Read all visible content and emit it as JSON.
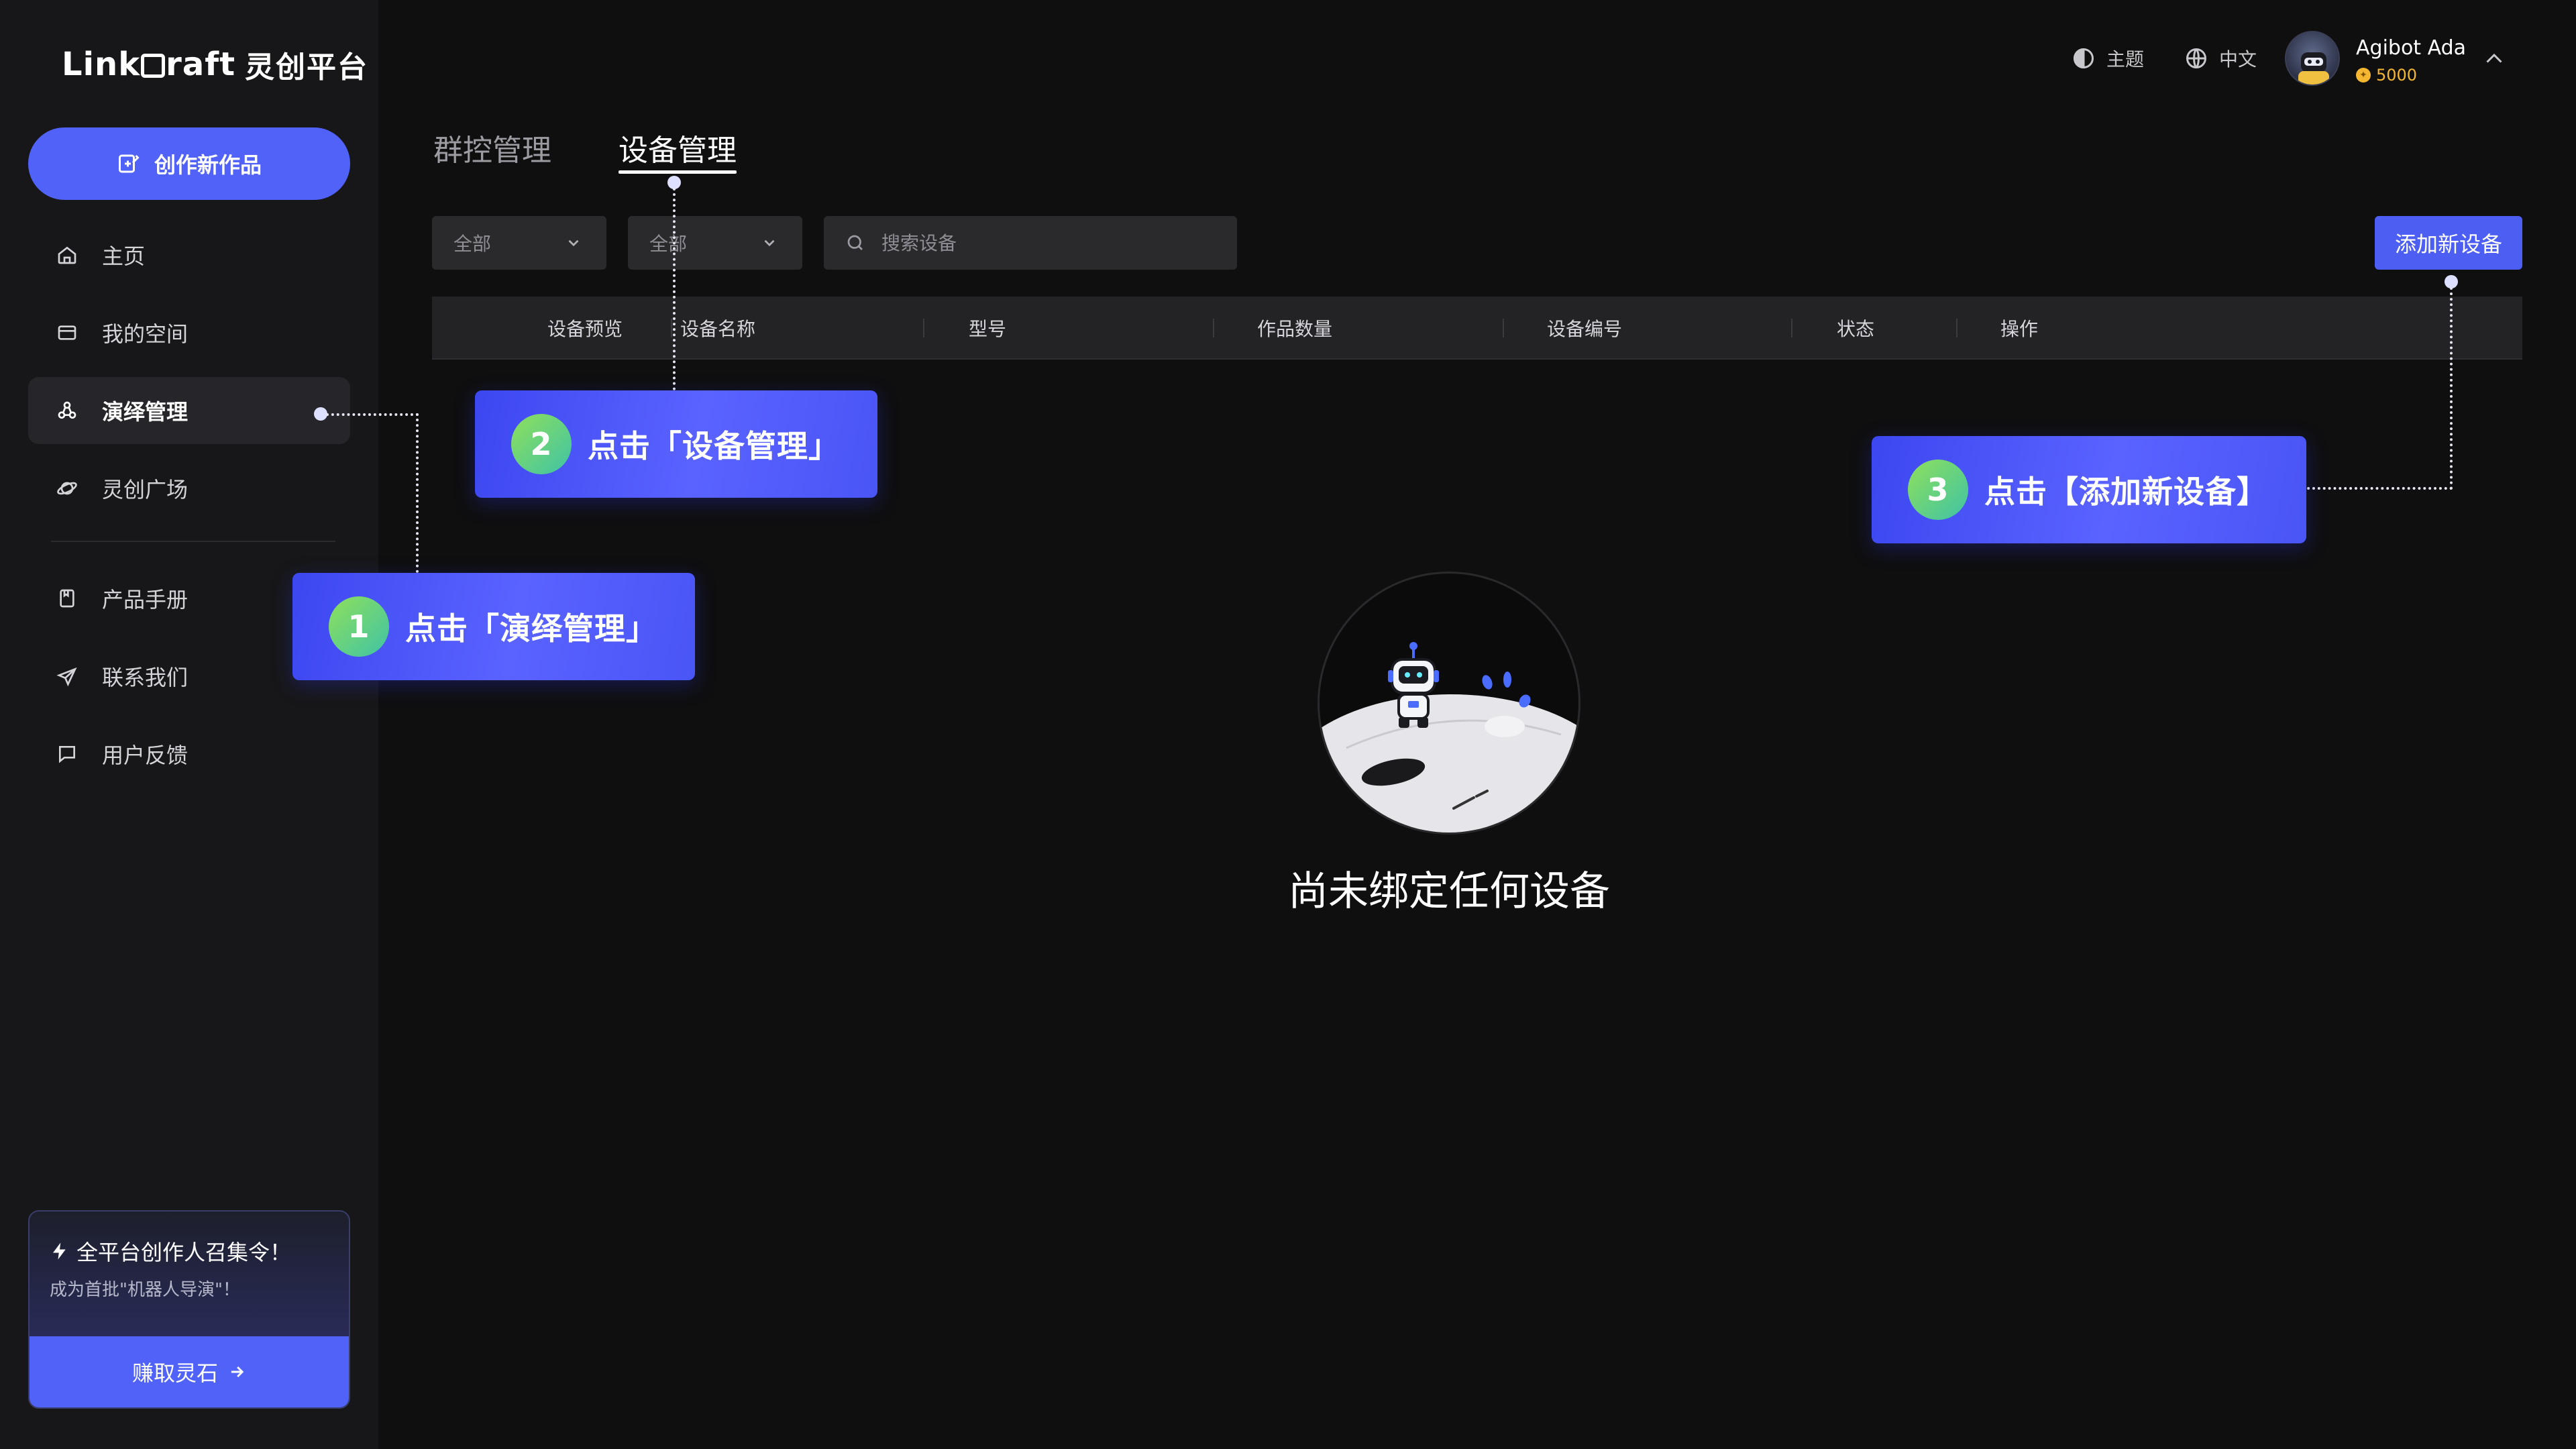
{
  "brand": {
    "name_en_left": "Link",
    "name_en_right": "raft",
    "name_cn": "灵创平台"
  },
  "sidebar": {
    "create_label": "创作新作品",
    "items": [
      {
        "label": "主页",
        "icon": "home-icon"
      },
      {
        "label": "我的空间",
        "icon": "folder-icon"
      },
      {
        "label": "演绎管理",
        "icon": "nodes-icon",
        "active": true
      },
      {
        "label": "灵创广场",
        "icon": "planet-icon"
      },
      {
        "label": "产品手册",
        "icon": "book-icon"
      },
      {
        "label": "联系我们",
        "icon": "send-icon"
      },
      {
        "label": "用户反馈",
        "icon": "chat-icon"
      }
    ],
    "promo": {
      "title": "全平台创作人召集令！",
      "subtitle": "成为首批\"机器人导演\"！",
      "button": "赚取灵石"
    }
  },
  "header": {
    "theme_label": "主题",
    "lang_label": "中文",
    "user": {
      "name": "Agibot Ada",
      "coins": "5000"
    }
  },
  "tabs": [
    {
      "label": "群控管理",
      "active": false
    },
    {
      "label": "设备管理",
      "active": true
    }
  ],
  "toolbar": {
    "filter1": "全部",
    "filter2": "全部",
    "search_placeholder": "搜索设备",
    "add_button": "添加新设备"
  },
  "table": {
    "columns": [
      "设备预览",
      "设备名称",
      "型号",
      "作品数量",
      "设备编号",
      "状态",
      "操作"
    ]
  },
  "empty": {
    "text": "尚未绑定任何设备"
  },
  "callouts": [
    {
      "number": "1",
      "text": "点击「演绎管理」"
    },
    {
      "number": "2",
      "text": "点击「设备管理」"
    },
    {
      "number": "3",
      "text": "点击【添加新设备】"
    }
  ],
  "colors": {
    "accent": "#5062f7",
    "background": "#0f0f10",
    "sidebar": "#171719",
    "coin": "#f5b731"
  }
}
